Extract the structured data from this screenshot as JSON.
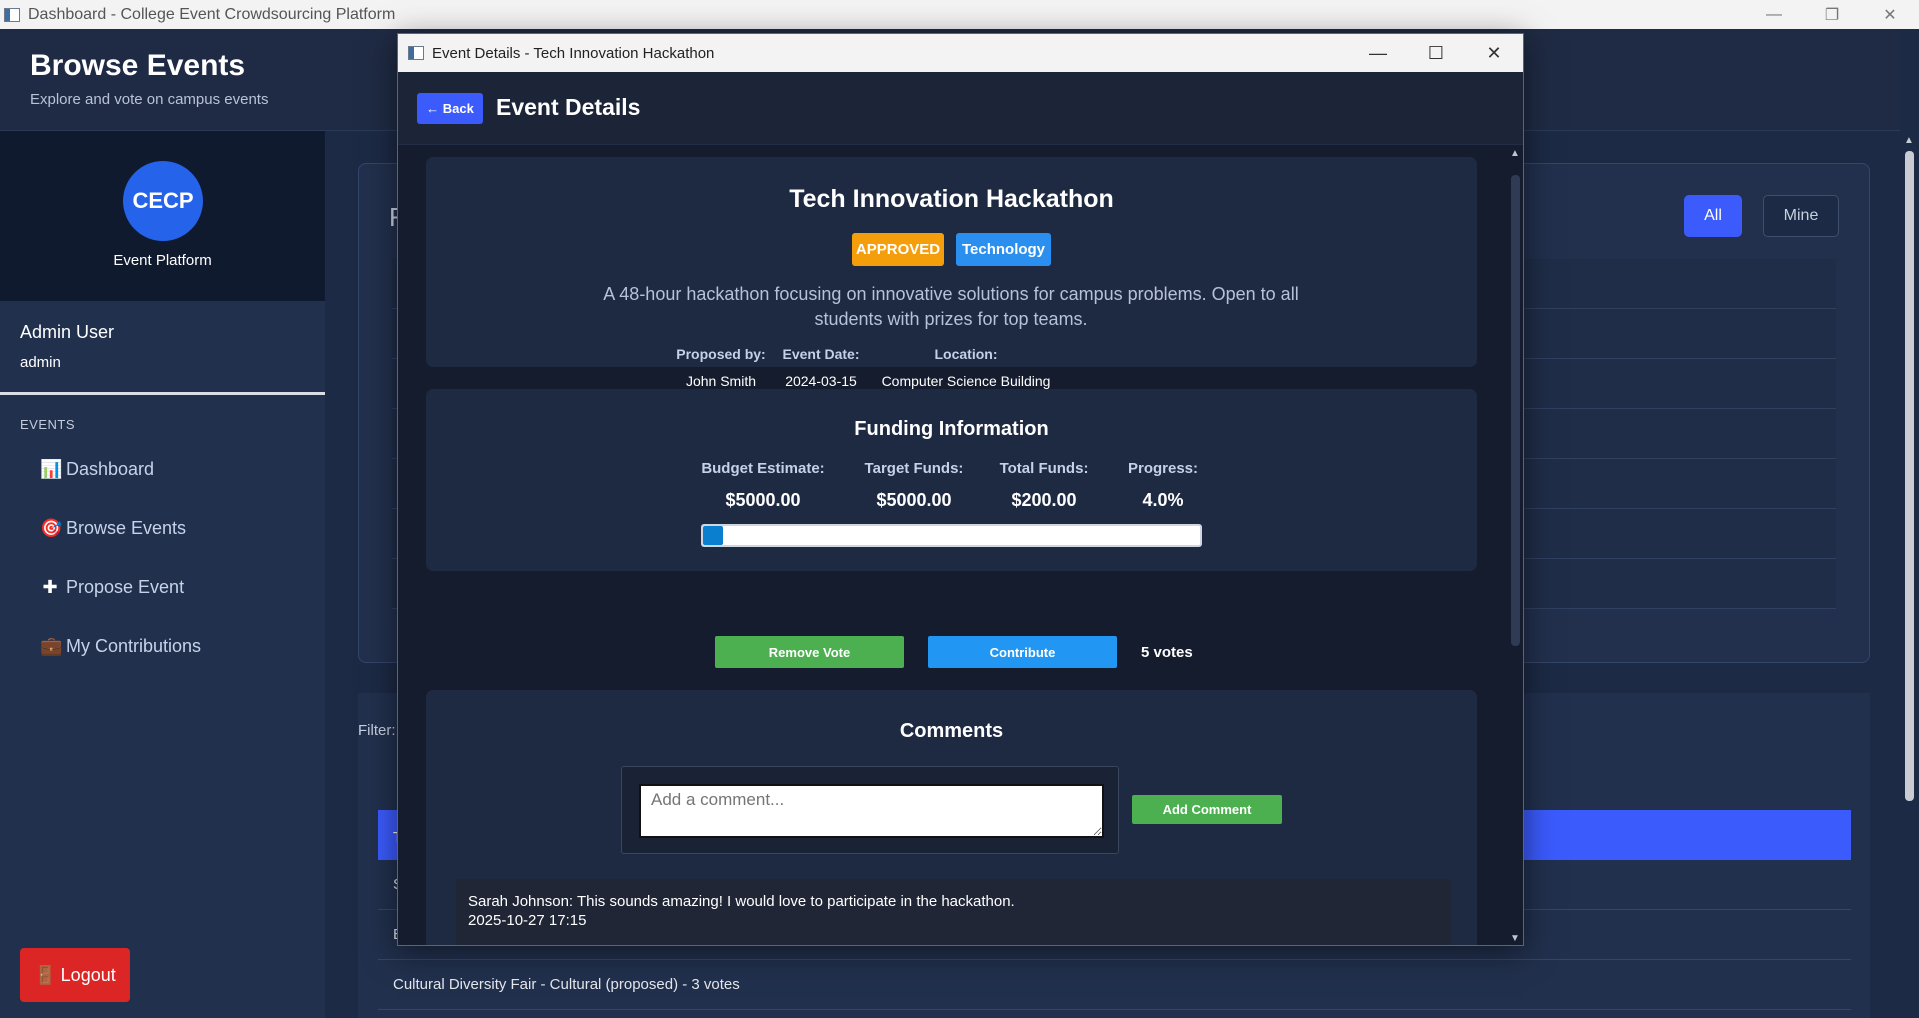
{
  "window": {
    "title": "Dashboard - College Event Crowdsourcing Platform",
    "controls": [
      "minimize",
      "restore",
      "close"
    ]
  },
  "header": {
    "title": "Browse Events",
    "subtitle": "Explore and vote on campus events"
  },
  "sidebar": {
    "logo_text": "CECP",
    "brand_name": "Event Platform",
    "user_name": "Admin User",
    "user_role": "admin",
    "section_label": "EVENTS",
    "items": [
      {
        "icon": "chart-icon",
        "glyph": "📊",
        "label": "Dashboard"
      },
      {
        "icon": "target-icon",
        "glyph": "🎯",
        "label": "Browse Events"
      },
      {
        "icon": "plus-icon",
        "glyph": "✚",
        "label": "Propose Event"
      },
      {
        "icon": "briefcase-icon",
        "glyph": "💼",
        "label": "My Contributions"
      }
    ],
    "logout_label": "Logout",
    "logout_glyph": "🚪"
  },
  "background": {
    "card_peek_text": "F",
    "filter_all": "All",
    "filter_mine": "Mine",
    "filter_label": "Filter:",
    "list_peek": [
      "T",
      "S",
      "E"
    ],
    "last_row": "Cultural Diversity Fair - Cultural (proposed) - 3 votes"
  },
  "dialog": {
    "window_title": "Event Details - Tech Innovation Hackathon",
    "back_label": "← Back",
    "header_title": "Event Details",
    "event": {
      "title": "Tech Innovation Hackathon",
      "status": "APPROVED",
      "category": "Technology",
      "description": "A 48-hour hackathon focusing on innovative solutions for campus problems. Open to all students with prizes for top teams.",
      "proposed_by_label": "Proposed by:",
      "proposed_by": "John Smith",
      "date_label": "Event Date:",
      "date": "2024-03-15",
      "location_label": "Location:",
      "location": "Computer Science Building"
    },
    "funding": {
      "title": "Funding Information",
      "budget_label": "Budget Estimate:",
      "budget": "$5000.00",
      "target_label": "Target Funds:",
      "target": "$5000.00",
      "total_label": "Total Funds:",
      "total": "$200.00",
      "progress_label": "Progress:",
      "progress_text": "4.0%",
      "progress_fraction": 0.04
    },
    "actions": {
      "vote_label": "Remove Vote",
      "contribute_label": "Contribute",
      "votes_text": "5 votes"
    },
    "comments": {
      "title": "Comments",
      "placeholder": "Add a comment...",
      "add_label": "Add Comment",
      "items": [
        {
          "text": "Sarah Johnson: This sounds amazing! I would love to participate in the hackathon.",
          "time": "2025-10-27 17:15"
        }
      ]
    }
  },
  "colors": {
    "accent": "#3b5bfd",
    "approved": "#f59e0b",
    "category": "#2b8ff0",
    "vote": "#4caf50",
    "contribute": "#2196f3",
    "logout": "#dc2626"
  }
}
